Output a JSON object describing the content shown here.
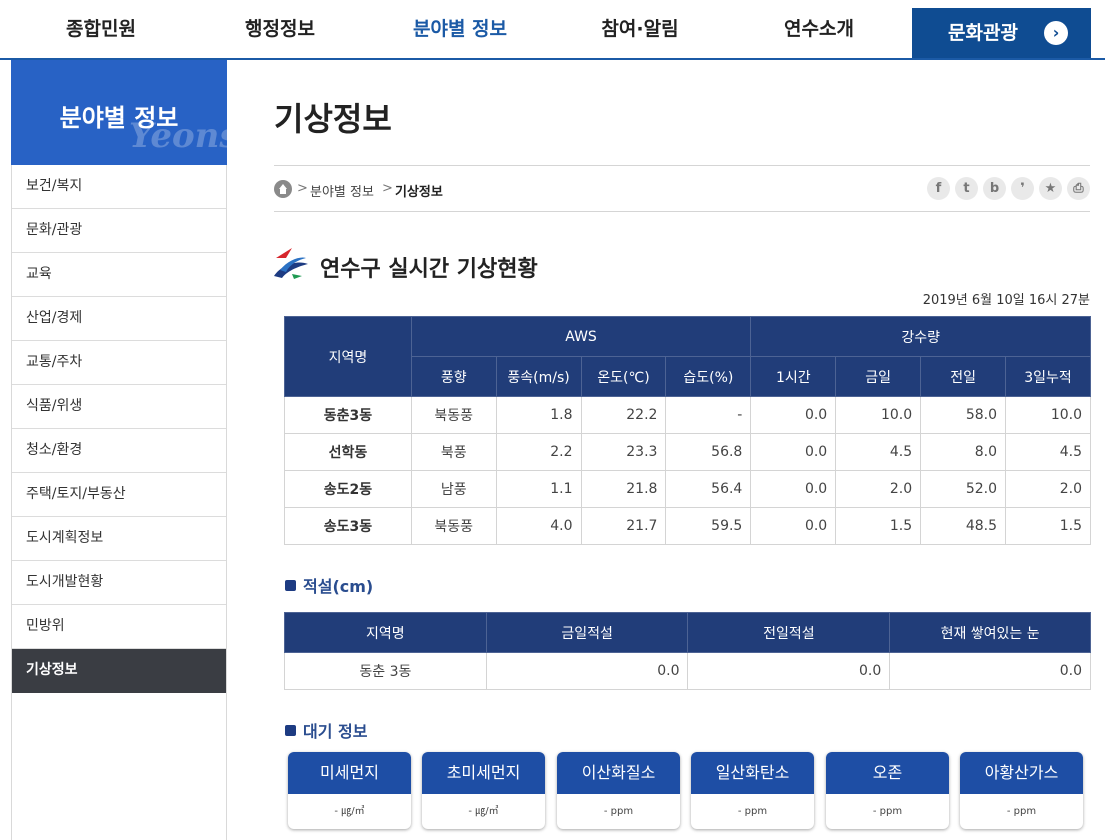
{
  "nav": {
    "items": [
      "종합민원",
      "행정정보",
      "분야별 정보",
      "참여·알림",
      "연수소개"
    ],
    "active_index": 2,
    "culture": "문화관광",
    "culture_arrow": "›"
  },
  "sidebar": {
    "title": "분야별 정보",
    "deco": "Yeonsu",
    "items": [
      "보건/복지",
      "문화/관광",
      "교육",
      "산업/경제",
      "교통/주차",
      "식품/위생",
      "청소/환경",
      "주택/토지/부동산",
      "도시계획정보",
      "도시개발현황",
      "민방위",
      "기상정보"
    ],
    "active_index": 11
  },
  "page": {
    "title": "기상정보",
    "breadcrumb": [
      "분야별 정보",
      "기상정보"
    ],
    "breadcrumb_sep": ">",
    "share_icons": [
      "facebook-icon",
      "twitter-icon",
      "blog-icon",
      "kakao-icon",
      "bookmark-icon",
      "print-icon"
    ],
    "share_glyphs": [
      "f",
      "t",
      "b",
      "❜",
      "★",
      "⎙"
    ]
  },
  "weather": {
    "section_title": "연수구 실시간 기상현황",
    "timestamp": "2019년 6월 10일 16시 27분",
    "headers": {
      "region": "지역명",
      "aws": "AWS",
      "rain": "강수량",
      "aws_cols": [
        "풍향",
        "풍속(m/s)",
        "온도(℃)",
        "습도(%)"
      ],
      "rain_cols": [
        "1시간",
        "금일",
        "전일",
        "3일누적"
      ]
    },
    "rows": [
      {
        "region": "동춘3동",
        "wind_dir": "북동풍",
        "wind_speed": "1.8",
        "temp": "22.2",
        "humidity": "-",
        "rain_1h": "0.0",
        "rain_today": "10.0",
        "rain_yesterday": "58.0",
        "rain_3d": "10.0"
      },
      {
        "region": "선학동",
        "wind_dir": "북풍",
        "wind_speed": "2.2",
        "temp": "23.3",
        "humidity": "56.8",
        "rain_1h": "0.0",
        "rain_today": "4.5",
        "rain_yesterday": "8.0",
        "rain_3d": "4.5"
      },
      {
        "region": "송도2동",
        "wind_dir": "남풍",
        "wind_speed": "1.1",
        "temp": "21.8",
        "humidity": "56.4",
        "rain_1h": "0.0",
        "rain_today": "2.0",
        "rain_yesterday": "52.0",
        "rain_3d": "2.0"
      },
      {
        "region": "송도3동",
        "wind_dir": "북동풍",
        "wind_speed": "4.0",
        "temp": "21.7",
        "humidity": "59.5",
        "rain_1h": "0.0",
        "rain_today": "1.5",
        "rain_yesterday": "48.5",
        "rain_3d": "1.5"
      }
    ]
  },
  "snow": {
    "title": "적설(cm)",
    "headers": [
      "지역명",
      "금일적설",
      "전일적설",
      "현재 쌓여있는 눈"
    ],
    "rows": [
      {
        "region": "동춘 3동",
        "today": "0.0",
        "yesterday": "0.0",
        "current": "0.0"
      }
    ]
  },
  "air": {
    "title": "대기 정보",
    "items": [
      {
        "name": "미세먼지",
        "value": "- ㎍/㎥"
      },
      {
        "name": "초미세먼지",
        "value": "- ㎍/㎥"
      },
      {
        "name": "이산화질소",
        "value": "- ppm"
      },
      {
        "name": "일산화탄소",
        "value": "- ppm"
      },
      {
        "name": "오존",
        "value": "- ppm"
      },
      {
        "name": "아황산가스",
        "value": "- ppm"
      }
    ]
  },
  "colors": {
    "nav_active": "#1b5aa6",
    "culture_bg": "#0f4c92",
    "sidebar_head": "#2862c5",
    "sidebar_active": "#3a3d43",
    "table_header": "#213d79",
    "air_header": "#1e4ea5"
  }
}
